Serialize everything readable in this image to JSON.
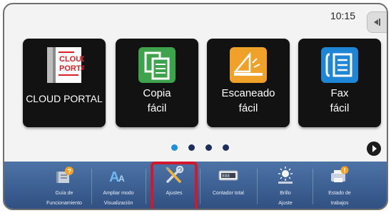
{
  "status": {
    "time": "10:15"
  },
  "apps": [
    {
      "name": "cloud-portal",
      "label": "CLOUD PORTAL",
      "logo_text_1": "CLOUD",
      "logo_text_2": "PORTAL"
    },
    {
      "name": "copia-facil",
      "label": "Copia\nfácil"
    },
    {
      "name": "escaneado-facil",
      "label": "Escaneado\nfácil"
    },
    {
      "name": "fax-facil",
      "label": "Fax\nfácil"
    }
  ],
  "pager": {
    "current": 1,
    "total": 4
  },
  "shortcuts": [
    {
      "label": "Guía de\nFuncionamiento",
      "icon": "help-book-icon"
    },
    {
      "label": "Ampliar modo\nVisualización",
      "icon": "text-enlarge-icon"
    },
    {
      "label": "Ajustes",
      "icon": "wrench-screwdriver-icon"
    },
    {
      "label": "Contador total",
      "icon": "counter-icon"
    },
    {
      "label": "Brillo\nAjuste",
      "icon": "brightness-icon"
    },
    {
      "label": "Estado de\ntrabajos",
      "icon": "job-status-icon"
    }
  ],
  "colors": {
    "highlight": "#d1192e",
    "active_dot": "#1e8fe0",
    "shortcut_bar": "#3d6192",
    "copy_icon": "#3fa34d",
    "scan_icon": "#f0a12a",
    "fax_icon": "#1f86d6",
    "cloud_red": "#d92127"
  }
}
